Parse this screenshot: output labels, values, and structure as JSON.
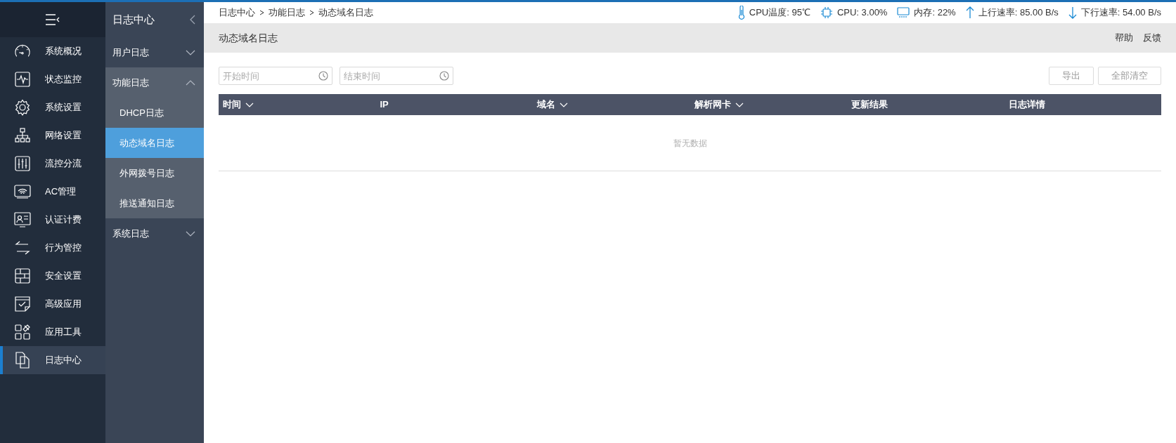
{
  "nav": {
    "items": [
      {
        "label": "系统概况",
        "selected": false
      },
      {
        "label": "状态监控",
        "selected": false
      },
      {
        "label": "系统设置",
        "selected": false
      },
      {
        "label": "网络设置",
        "selected": false
      },
      {
        "label": "流控分流",
        "selected": false
      },
      {
        "label": "AC管理",
        "selected": false
      },
      {
        "label": "认证计费",
        "selected": false
      },
      {
        "label": "行为管控",
        "selected": false
      },
      {
        "label": "安全设置",
        "selected": false
      },
      {
        "label": "高级应用",
        "selected": false
      },
      {
        "label": "应用工具",
        "selected": false
      },
      {
        "label": "日志中心",
        "selected": true
      }
    ]
  },
  "subnav": {
    "title": "日志中心",
    "groups": [
      {
        "label": "用户日志",
        "expanded": false
      },
      {
        "label": "功能日志",
        "expanded": true,
        "children": [
          {
            "label": "DHCP日志",
            "selected": false
          },
          {
            "label": "动态域名日志",
            "selected": true
          },
          {
            "label": "外网拨号日志",
            "selected": false
          },
          {
            "label": "推送通知日志",
            "selected": false
          }
        ]
      },
      {
        "label": "系统日志",
        "expanded": false
      }
    ]
  },
  "breadcrumb": [
    "日志中心",
    "功能日志",
    "动态域名日志"
  ],
  "status": [
    {
      "kind": "temperature",
      "text": "CPU温度: 95℃"
    },
    {
      "kind": "cpu",
      "text": "CPU: 3.00%"
    },
    {
      "kind": "memory",
      "text": "内存: 22%"
    },
    {
      "kind": "upload",
      "text": "上行速率: 85.00 B/s"
    },
    {
      "kind": "download",
      "text": "下行速率: 54.00 B/s"
    }
  ],
  "page_title": "动态域名日志",
  "header_links": [
    "帮助",
    "反馈"
  ],
  "filters": [
    {
      "placeholder": "开始时间"
    },
    {
      "placeholder": "结束时间"
    }
  ],
  "buttons": [
    "导出",
    "全部清空"
  ],
  "table": {
    "columns": [
      {
        "label": "时间",
        "sortable": true
      },
      {
        "label": "IP",
        "sortable": false
      },
      {
        "label": "域名",
        "sortable": true
      },
      {
        "label": "解析网卡",
        "sortable": true
      },
      {
        "label": "更新结果",
        "sortable": false
      },
      {
        "label": "日志详情",
        "sortable": false
      }
    ],
    "empty_text": "暂无数据"
  }
}
